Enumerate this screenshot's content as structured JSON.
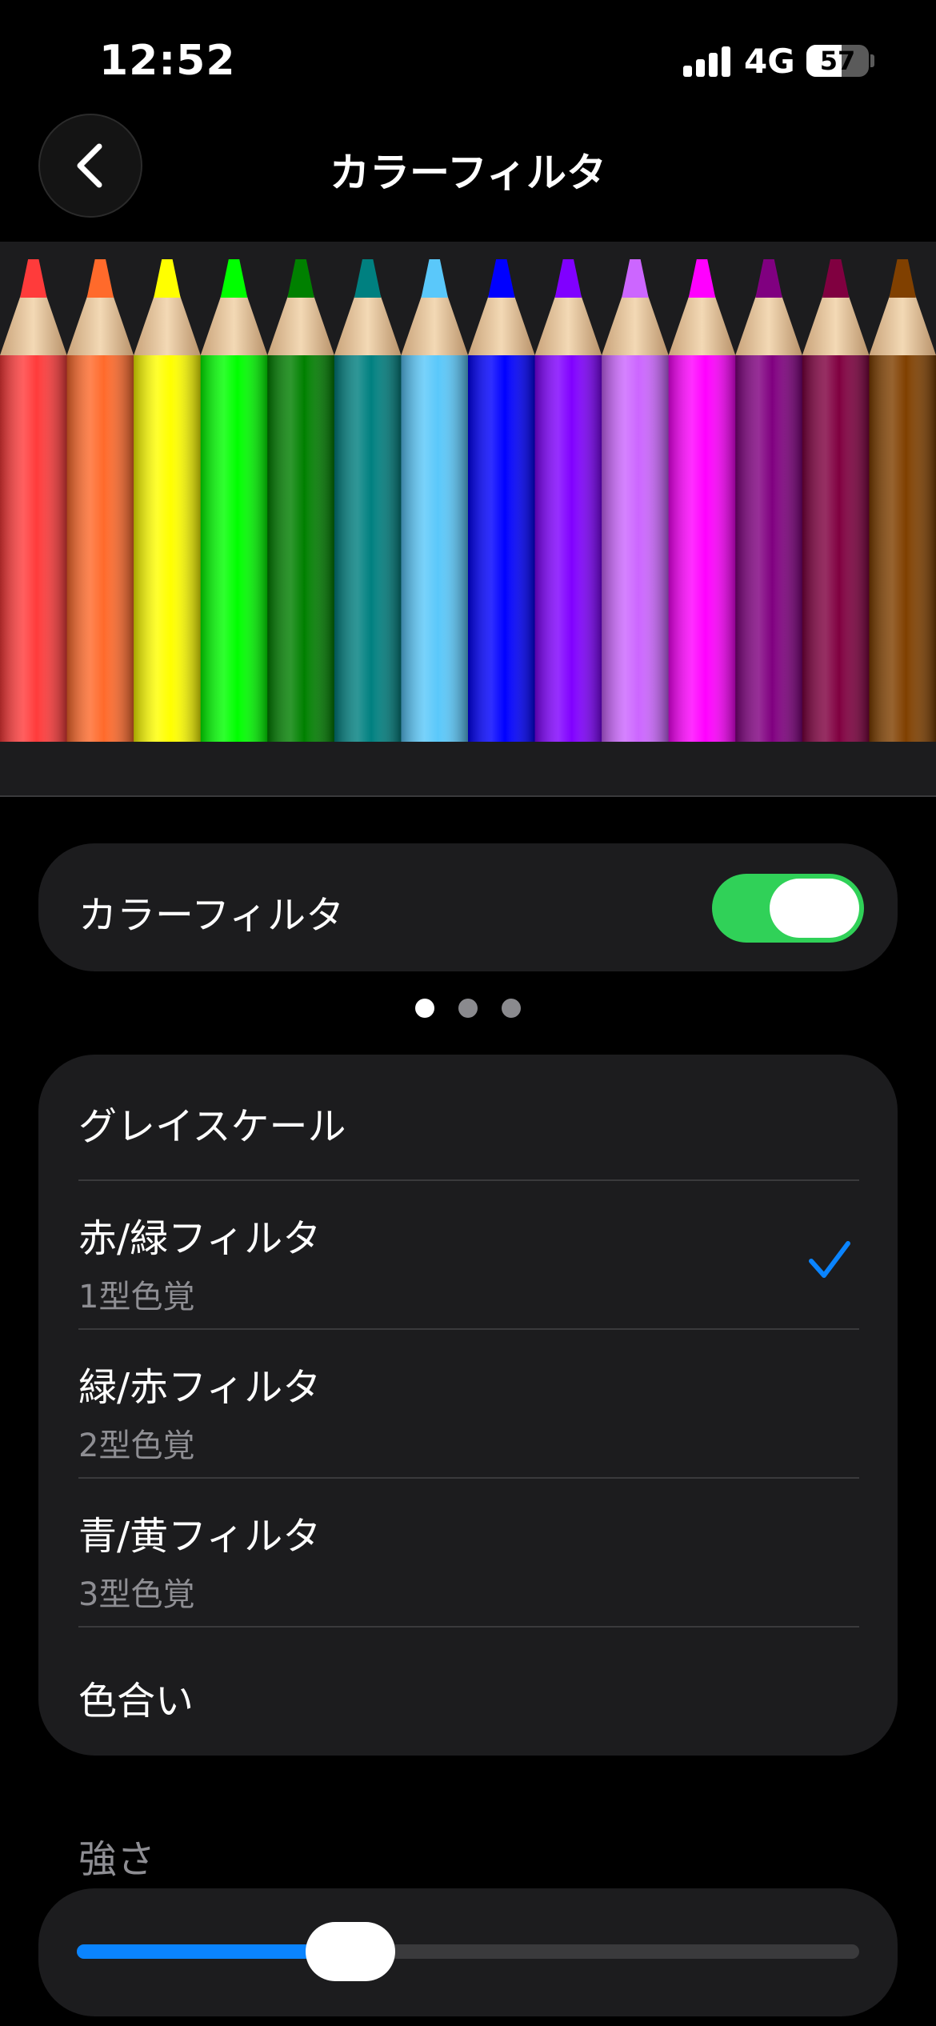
{
  "status_bar": {
    "time": "12:52",
    "network": "4G",
    "battery_percent": "57"
  },
  "nav": {
    "title": "カラーフィルタ",
    "back_icon": "chevron-left-icon"
  },
  "banner": {
    "pencil_colors": [
      "#ff3b3b",
      "#ff6a2b",
      "#ffff00",
      "#00ff00",
      "#008000",
      "#008080",
      "#5ac8fa",
      "#0000ff",
      "#8000ff",
      "#cc66ff",
      "#ff00ff",
      "#800080",
      "#800040",
      "#804000"
    ],
    "pages": 3,
    "active_page": 1
  },
  "toggle": {
    "label": "カラーフィルタ",
    "on": true
  },
  "filters": [
    {
      "title": "グレイスケール",
      "subtitle": "",
      "selected": false
    },
    {
      "title": "赤/緑フィルタ",
      "subtitle": "1型色覚",
      "selected": true
    },
    {
      "title": "緑/赤フィルタ",
      "subtitle": "2型色覚",
      "selected": false
    },
    {
      "title": "青/黄フィルタ",
      "subtitle": "3型色覚",
      "selected": false
    },
    {
      "title": "色合い",
      "subtitle": "",
      "selected": false
    }
  ],
  "intensity": {
    "label": "強さ",
    "value": 0.35
  },
  "colors": {
    "accent": "#0a84ff",
    "toggle_on": "#30d158",
    "card": "#1c1c1e"
  }
}
